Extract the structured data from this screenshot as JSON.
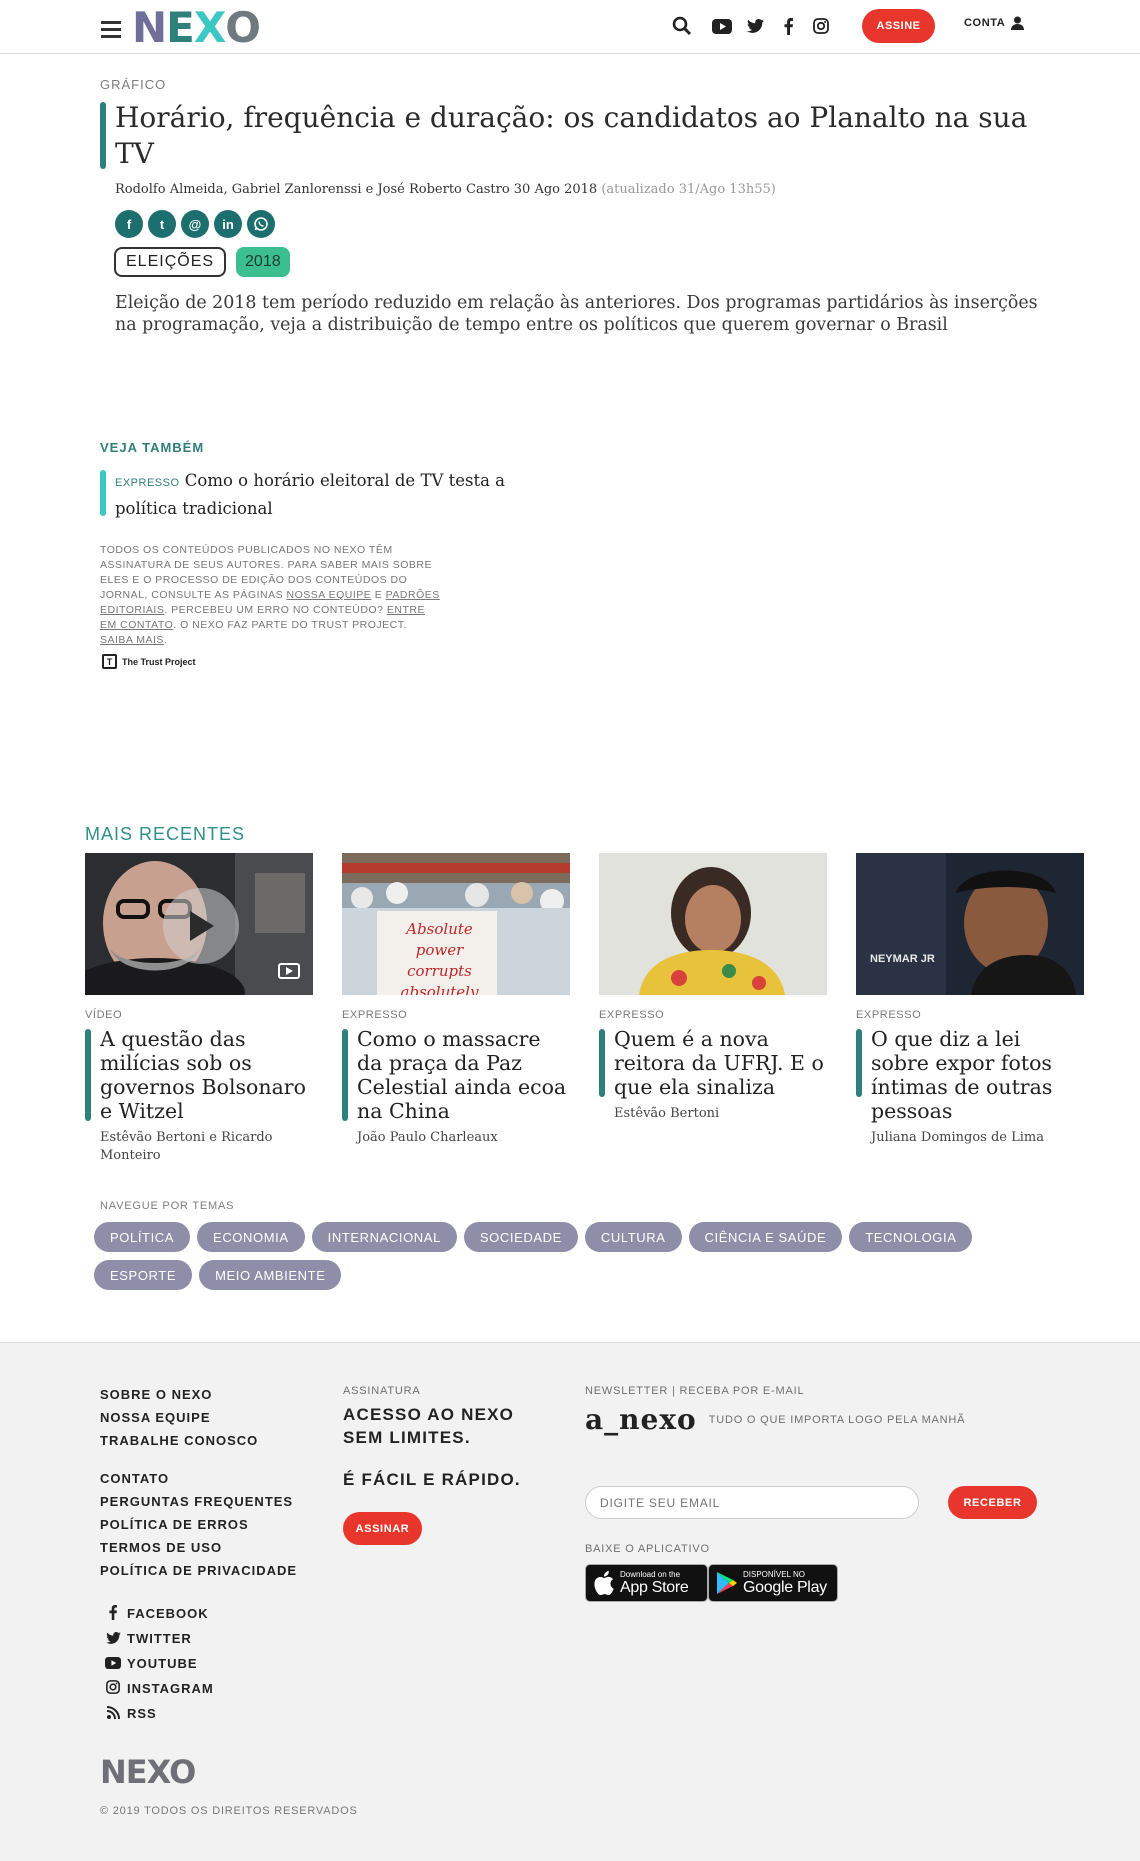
{
  "header": {
    "logo": "NEXO",
    "assine_label": "ASSINE",
    "conta_label": "CONTA"
  },
  "article": {
    "kicker": "GRÁFICO",
    "title": "Horário, frequência e duração: os candidatos ao Planalto na sua TV",
    "authors_date": "Rodolfo Almeida, Gabriel Zanlorenssi e José Roberto Castro 30 Ago 2018",
    "updated": "(atualizado 31/Ago 13h55)",
    "share_icons": [
      "f",
      "t",
      "@",
      "in",
      "w"
    ],
    "tags": [
      "ELEIÇÕES",
      "2018"
    ],
    "lead": "Eleição de 2018 tem período reduzido em relação às anteriores. Dos programas partidários às inserções na programação, veja a distribuição de tempo entre os políticos que querem governar o Brasil"
  },
  "veja_tambem": {
    "label": "VEJA TAMBÉM",
    "item_kicker": "EXPRESSO",
    "item_title": "Como o horário eleitoral de TV testa a política tradicional"
  },
  "trust": {
    "text_1": "Todos os conteúdos publicados no Nexo têm assinatura de seus autores. Para saber mais sobre eles e o processo de edição dos conteúdos do jornal, consulte as páginas",
    "link_equipe": "Nossa equipe",
    "conj": "e",
    "link_padroes": "Padrões editoriais",
    "text_2": ". Percebeu um erro no conteúdo?",
    "link_contato": "Entre em contato",
    "text_3": ". O Nexo faz parte do Trust Project.",
    "link_saiba": "Saiba mais",
    "text_4": ".",
    "logo_label": "The Trust Project"
  },
  "mais_recentes": {
    "label": "MAIS RECENTES",
    "cards": [
      {
        "kicker": "VÍDEO",
        "title": "A questão das milícias sob os governos Bolsonaro e Witzel",
        "author": "Estêvão Bertoni e Ricardo Monteiro"
      },
      {
        "kicker": "EXPRESSO",
        "title": "Como o massacre da praça da Paz Celestial ainda ecoa na China",
        "author": "João Paulo Charleaux"
      },
      {
        "kicker": "EXPRESSO",
        "title": "Quem é a nova reitora da UFRJ. E o que ela sinaliza",
        "author": "Estêvão Bertoni"
      },
      {
        "kicker": "EXPRESSO",
        "title": "O que diz a lei sobre expor fotos íntimas de outras pessoas",
        "author": "Juliana Domingos de Lima"
      }
    ],
    "sign_lines": [
      "Absolute power",
      "corrupts",
      "absolutely"
    ],
    "banner_text": "NEYMAR JR"
  },
  "temas": {
    "label": "NAVEGUE POR TEMAS",
    "items": [
      "POLÍTICA",
      "ECONOMIA",
      "INTERNACIONAL",
      "SOCIEDADE",
      "CULTURA",
      "CIÊNCIA E SAÚDE",
      "TECNOLOGIA",
      "ESPORTE",
      "MEIO AMBIENTE"
    ]
  },
  "footer": {
    "links_a": [
      "SOBRE O NEXO",
      "NOSSA EQUIPE",
      "TRABALHE CONOSCO"
    ],
    "links_b": [
      "CONTATO",
      "PERGUNTAS FREQUENTES",
      "POLÍTICA DE ERROS",
      "TERMOS DE USO",
      "POLÍTICA DE PRIVACIDADE"
    ],
    "social": [
      {
        "icon": "facebook-icon",
        "label": "FACEBOOK"
      },
      {
        "icon": "twitter-icon",
        "label": "TWITTER"
      },
      {
        "icon": "youtube-icon",
        "label": "YOUTUBE"
      },
      {
        "icon": "instagram-icon",
        "label": "INSTAGRAM"
      },
      {
        "icon": "rss-icon",
        "label": "RSS"
      }
    ],
    "assinatura_label": "ASSINATURA",
    "assinatura_line1": "ACESSO AO NEXO",
    "assinatura_line2": "SEM LIMITES.",
    "assinatura_line3": "É FÁCIL E RÁPIDO.",
    "assinar_label": "ASSINAR",
    "newsletter_label": "NEWSLETTER | RECEBA POR E-MAIL",
    "anexo_logo": "a_nexo",
    "anexo_tagline": "TUDO O QUE IMPORTA LOGO PELA MANHÃ",
    "email_placeholder": "DIGITE SEU EMAIL",
    "receber_label": "RECEBER",
    "app_label": "BAIXE O APLICATIVO",
    "appstore_small": "Download on the",
    "appstore_big": "App Store",
    "gplay_small": "DISPONÍVEL NO",
    "gplay_big": "Google Play",
    "logo": "NEXO",
    "copyright": "© 2019 TODOS OS DIREITOS RESERVADOS"
  },
  "colors": {
    "accent_teal": "#2f7f7a",
    "accent_red": "#e8362c",
    "pill": "#8e8ea8",
    "tag_green": "#3cbf8f"
  }
}
